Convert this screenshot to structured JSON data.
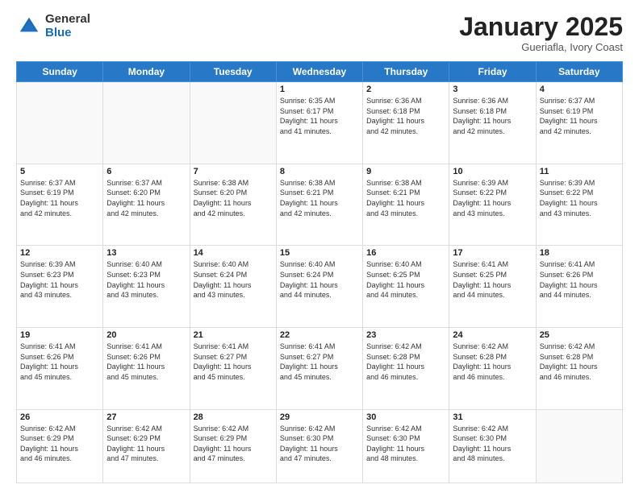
{
  "header": {
    "logo_general": "General",
    "logo_blue": "Blue",
    "month_title": "January 2025",
    "location": "Gueriafla, Ivory Coast"
  },
  "days_of_week": [
    "Sunday",
    "Monday",
    "Tuesday",
    "Wednesday",
    "Thursday",
    "Friday",
    "Saturday"
  ],
  "weeks": [
    [
      {
        "day": "",
        "info": ""
      },
      {
        "day": "",
        "info": ""
      },
      {
        "day": "",
        "info": ""
      },
      {
        "day": "1",
        "info": "Sunrise: 6:35 AM\nSunset: 6:17 PM\nDaylight: 11 hours\nand 41 minutes."
      },
      {
        "day": "2",
        "info": "Sunrise: 6:36 AM\nSunset: 6:18 PM\nDaylight: 11 hours\nand 42 minutes."
      },
      {
        "day": "3",
        "info": "Sunrise: 6:36 AM\nSunset: 6:18 PM\nDaylight: 11 hours\nand 42 minutes."
      },
      {
        "day": "4",
        "info": "Sunrise: 6:37 AM\nSunset: 6:19 PM\nDaylight: 11 hours\nand 42 minutes."
      }
    ],
    [
      {
        "day": "5",
        "info": "Sunrise: 6:37 AM\nSunset: 6:19 PM\nDaylight: 11 hours\nand 42 minutes."
      },
      {
        "day": "6",
        "info": "Sunrise: 6:37 AM\nSunset: 6:20 PM\nDaylight: 11 hours\nand 42 minutes."
      },
      {
        "day": "7",
        "info": "Sunrise: 6:38 AM\nSunset: 6:20 PM\nDaylight: 11 hours\nand 42 minutes."
      },
      {
        "day": "8",
        "info": "Sunrise: 6:38 AM\nSunset: 6:21 PM\nDaylight: 11 hours\nand 42 minutes."
      },
      {
        "day": "9",
        "info": "Sunrise: 6:38 AM\nSunset: 6:21 PM\nDaylight: 11 hours\nand 43 minutes."
      },
      {
        "day": "10",
        "info": "Sunrise: 6:39 AM\nSunset: 6:22 PM\nDaylight: 11 hours\nand 43 minutes."
      },
      {
        "day": "11",
        "info": "Sunrise: 6:39 AM\nSunset: 6:22 PM\nDaylight: 11 hours\nand 43 minutes."
      }
    ],
    [
      {
        "day": "12",
        "info": "Sunrise: 6:39 AM\nSunset: 6:23 PM\nDaylight: 11 hours\nand 43 minutes."
      },
      {
        "day": "13",
        "info": "Sunrise: 6:40 AM\nSunset: 6:23 PM\nDaylight: 11 hours\nand 43 minutes."
      },
      {
        "day": "14",
        "info": "Sunrise: 6:40 AM\nSunset: 6:24 PM\nDaylight: 11 hours\nand 43 minutes."
      },
      {
        "day": "15",
        "info": "Sunrise: 6:40 AM\nSunset: 6:24 PM\nDaylight: 11 hours\nand 44 minutes."
      },
      {
        "day": "16",
        "info": "Sunrise: 6:40 AM\nSunset: 6:25 PM\nDaylight: 11 hours\nand 44 minutes."
      },
      {
        "day": "17",
        "info": "Sunrise: 6:41 AM\nSunset: 6:25 PM\nDaylight: 11 hours\nand 44 minutes."
      },
      {
        "day": "18",
        "info": "Sunrise: 6:41 AM\nSunset: 6:26 PM\nDaylight: 11 hours\nand 44 minutes."
      }
    ],
    [
      {
        "day": "19",
        "info": "Sunrise: 6:41 AM\nSunset: 6:26 PM\nDaylight: 11 hours\nand 45 minutes."
      },
      {
        "day": "20",
        "info": "Sunrise: 6:41 AM\nSunset: 6:26 PM\nDaylight: 11 hours\nand 45 minutes."
      },
      {
        "day": "21",
        "info": "Sunrise: 6:41 AM\nSunset: 6:27 PM\nDaylight: 11 hours\nand 45 minutes."
      },
      {
        "day": "22",
        "info": "Sunrise: 6:41 AM\nSunset: 6:27 PM\nDaylight: 11 hours\nand 45 minutes."
      },
      {
        "day": "23",
        "info": "Sunrise: 6:42 AM\nSunset: 6:28 PM\nDaylight: 11 hours\nand 46 minutes."
      },
      {
        "day": "24",
        "info": "Sunrise: 6:42 AM\nSunset: 6:28 PM\nDaylight: 11 hours\nand 46 minutes."
      },
      {
        "day": "25",
        "info": "Sunrise: 6:42 AM\nSunset: 6:28 PM\nDaylight: 11 hours\nand 46 minutes."
      }
    ],
    [
      {
        "day": "26",
        "info": "Sunrise: 6:42 AM\nSunset: 6:29 PM\nDaylight: 11 hours\nand 46 minutes."
      },
      {
        "day": "27",
        "info": "Sunrise: 6:42 AM\nSunset: 6:29 PM\nDaylight: 11 hours\nand 47 minutes."
      },
      {
        "day": "28",
        "info": "Sunrise: 6:42 AM\nSunset: 6:29 PM\nDaylight: 11 hours\nand 47 minutes."
      },
      {
        "day": "29",
        "info": "Sunrise: 6:42 AM\nSunset: 6:30 PM\nDaylight: 11 hours\nand 47 minutes."
      },
      {
        "day": "30",
        "info": "Sunrise: 6:42 AM\nSunset: 6:30 PM\nDaylight: 11 hours\nand 48 minutes."
      },
      {
        "day": "31",
        "info": "Sunrise: 6:42 AM\nSunset: 6:30 PM\nDaylight: 11 hours\nand 48 minutes."
      },
      {
        "day": "",
        "info": ""
      }
    ]
  ]
}
